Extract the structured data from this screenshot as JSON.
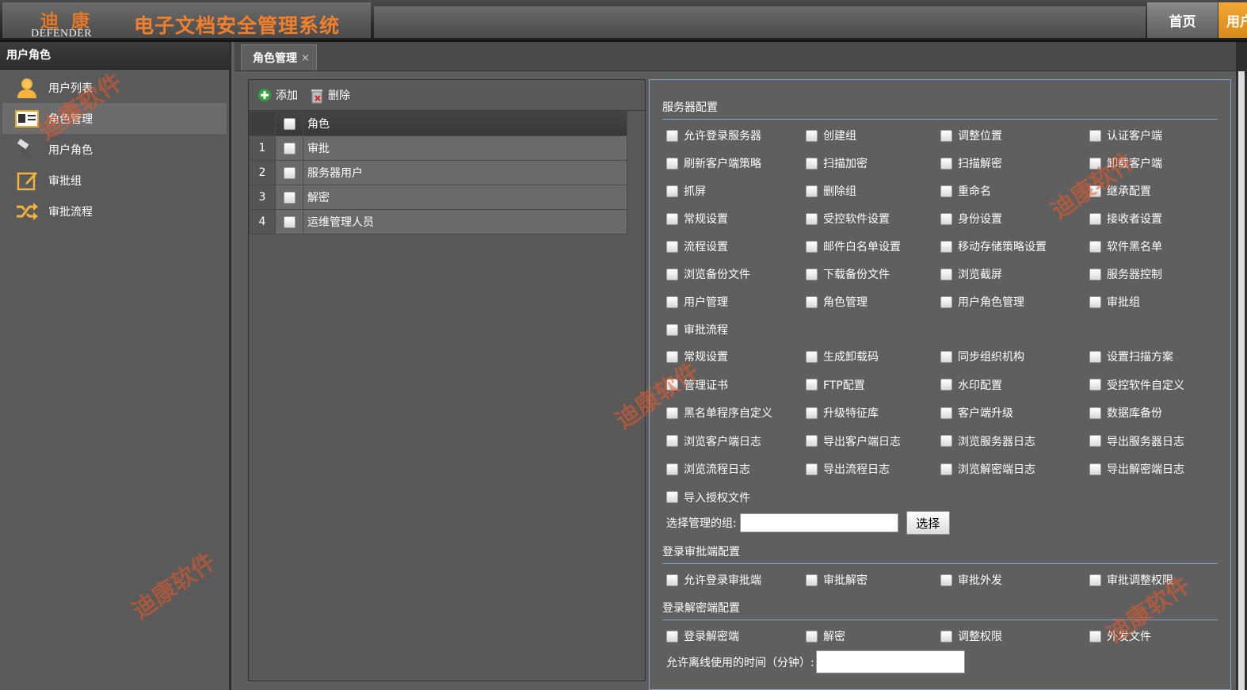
{
  "header": {
    "logo_cn": "迪康",
    "logo_en": "DEFENDER",
    "title": "电子文档安全管理系统",
    "nav": [
      "首页",
      "用户"
    ]
  },
  "sidebar": {
    "title": "用户角色",
    "items": [
      {
        "label": "用户列表",
        "icon": "user-icon"
      },
      {
        "label": "角色管理",
        "icon": "id-card-icon",
        "active": true
      },
      {
        "label": "用户角色",
        "icon": "hammer-icon"
      },
      {
        "label": "审批组",
        "icon": "edit-icon"
      },
      {
        "label": "审批流程",
        "icon": "shuffle-icon"
      }
    ]
  },
  "tab": {
    "label": "角色管理",
    "close": "×"
  },
  "toolbar": {
    "add": "添加",
    "delete": "删除"
  },
  "grid": {
    "column": "角色",
    "rows": [
      {
        "n": "1",
        "role": "审批"
      },
      {
        "n": "2",
        "role": "服务器用户"
      },
      {
        "n": "3",
        "role": "解密"
      },
      {
        "n": "4",
        "role": "运维管理人员"
      }
    ]
  },
  "config": {
    "server_title": "服务器配置",
    "server_options": [
      "允许登录服务器",
      "创建组",
      "调整位置",
      "认证客户端",
      "刷新客户端策略",
      "扫描加密",
      "扫描解密",
      "卸载客户端",
      "抓屏",
      "删除组",
      "重命名",
      "继承配置",
      "常规设置",
      "受控软件设置",
      "身份设置",
      "接收者设置",
      "流程设置",
      "邮件白名单设置",
      "移动存储策略设置",
      "软件黑名单",
      "浏览备份文件",
      "下载备份文件",
      "浏览截屏",
      "服务器控制",
      "用户管理",
      "角色管理",
      "用户角色管理",
      "审批组",
      "审批流程"
    ],
    "server_options2": [
      "常规设置",
      "生成卸载码",
      "同步组织机构",
      "设置扫描方案",
      "管理证书",
      "FTP配置",
      "水印配置",
      "受控软件自定义",
      "黑名单程序自定义",
      "升级特征库",
      "客户端升级",
      "数据库备份",
      "浏览客户端日志",
      "导出客户端日志",
      "浏览服务器日志",
      "导出服务器日志",
      "浏览流程日志",
      "导出流程日志",
      "浏览解密端日志",
      "导出解密端日志",
      "导入授权文件"
    ],
    "group_label": "选择管理的组:",
    "group_value": "",
    "choose_button": "选择",
    "approval_title": "登录审批端配置",
    "approval_options": [
      "允许登录审批端",
      "审批解密",
      "审批外发",
      "审批调整权限"
    ],
    "decrypt_title": "登录解密端配置",
    "decrypt_options": [
      "登录解密端",
      "解密",
      "调整权限",
      "外发文件"
    ],
    "offline_label": "允许离线使用的时间（分钟）:",
    "offline_value": ""
  },
  "watermark": "迪康软件",
  "colors": {
    "accent": "#f0802c",
    "panel_border": "#8aa0c8",
    "watermark": "#e65a28"
  }
}
